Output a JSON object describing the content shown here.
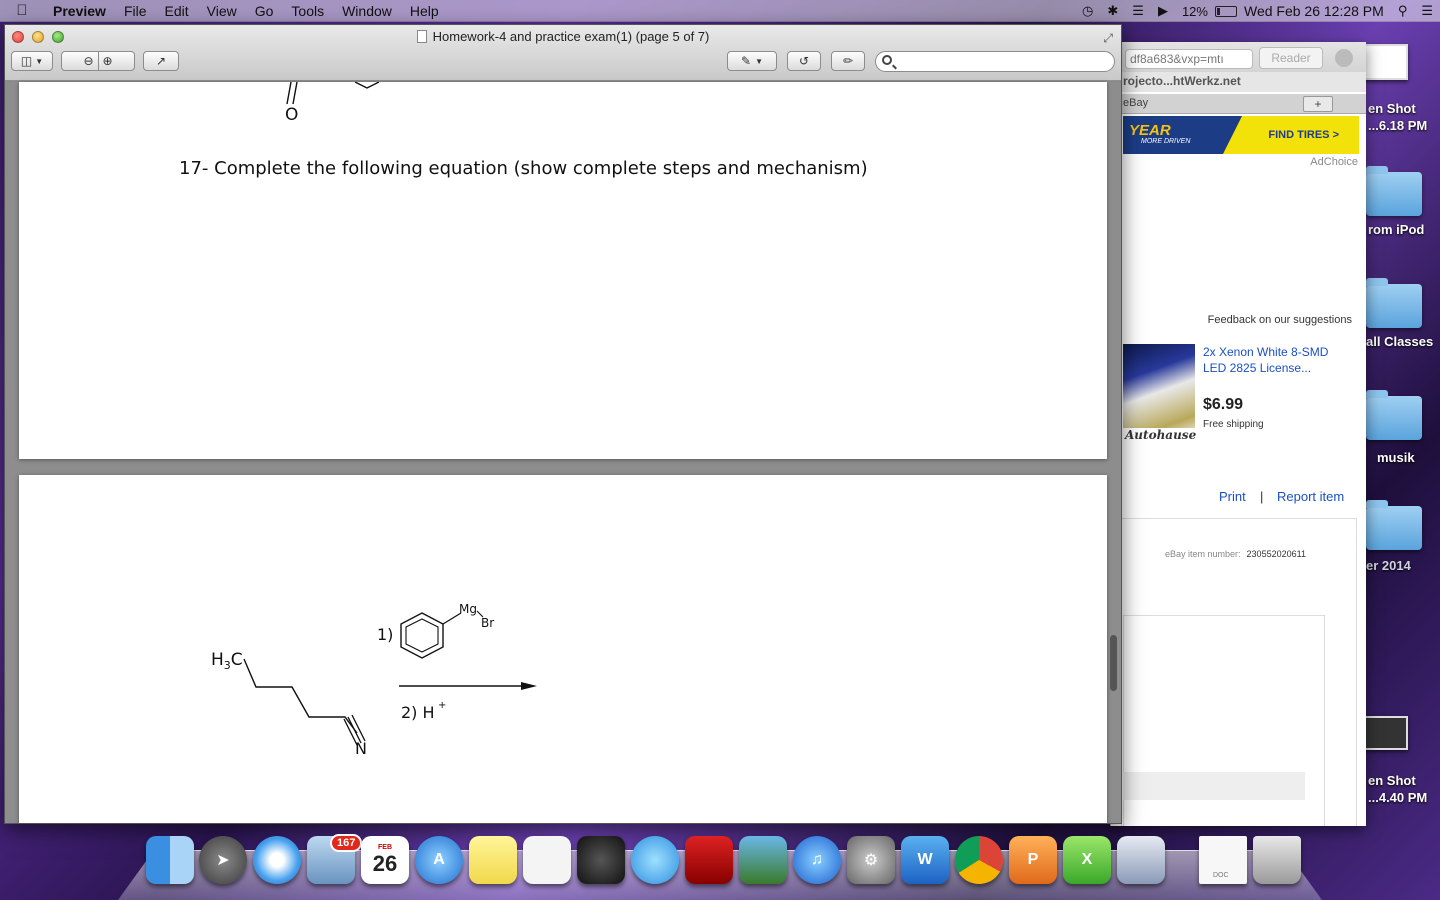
{
  "menubar": {
    "app_name": "Preview",
    "menus": [
      "File",
      "Edit",
      "View",
      "Go",
      "Tools",
      "Window",
      "Help"
    ],
    "battery": "12%",
    "clock": "Wed Feb 26  12:28 PM"
  },
  "desktop": {
    "items": [
      {
        "label": "en Shot\n...6.18 PM"
      },
      {
        "label": "rom iPod"
      },
      {
        "label": "all Classes"
      },
      {
        "label": "musik"
      },
      {
        "label": "er 2014"
      },
      {
        "label": "en Shot\n...4.40 PM"
      }
    ]
  },
  "browser": {
    "url": "df8a683&vxp=mtı",
    "reader": "Reader",
    "bookmark": "rojecto...htWerkz.net",
    "tab": "eBay",
    "banner_brand": "YEAR",
    "banner_sub": "MORE DRIVEN",
    "banner_cta": "FIND TIRES >",
    "adchoice": "AdChoice",
    "feedback": "Feedback on our suggestions",
    "ad_title": "2x Xenon White 8-SMD LED 2825 License...",
    "ad_price": "$6.99",
    "ad_shipping": "Free shipping",
    "ad_brand": "Autohause",
    "print": "Print",
    "separator": "|",
    "report": "Report item",
    "item_number_label": "eBay item number:",
    "item_number": "230552020611"
  },
  "preview": {
    "title": "Homework-4 and practice exam(1) (page 5 of 7)",
    "search_placeholder": "",
    "question": "17- Complete the following equation (show complete steps and mechanism)",
    "chem": {
      "o_label": "O",
      "h3c": "H",
      "h3c_sub": "3",
      "h3c_c": "C",
      "n_label": "N",
      "step1": "1)",
      "mg": "Mg",
      "br": "Br",
      "step2": "2) H",
      "plus": "+"
    }
  },
  "dock": {
    "calendar_month": "FEB",
    "calendar_day": "26",
    "mail_badge": "167",
    "doc_label": "DOC"
  }
}
